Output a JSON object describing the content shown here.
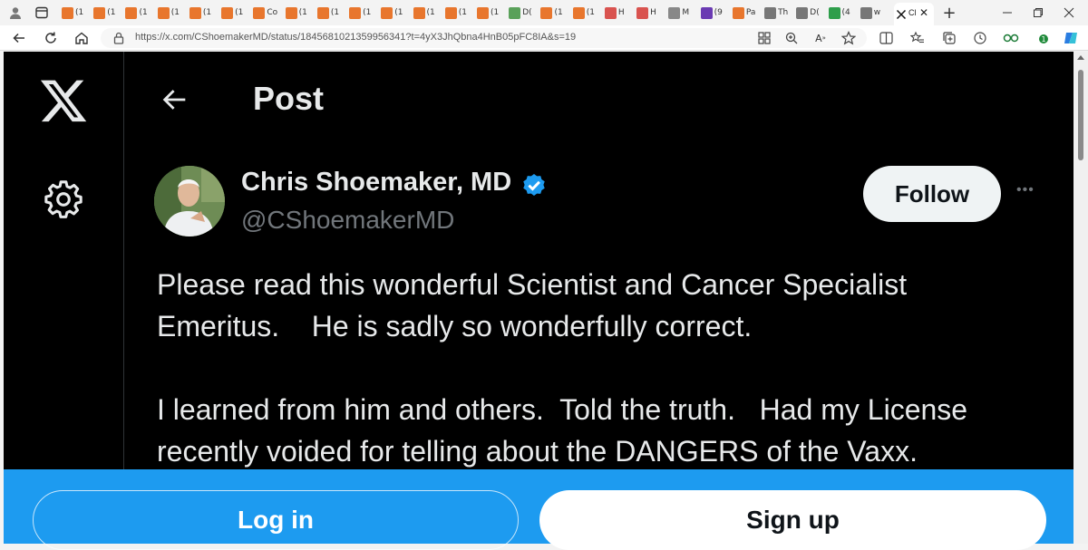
{
  "browser": {
    "tabs": [
      {
        "label": "(1",
        "color": "#e8762d"
      },
      {
        "label": "(1",
        "color": "#e8762d"
      },
      {
        "label": "(1",
        "color": "#e8762d"
      },
      {
        "label": "(1",
        "color": "#e8762d"
      },
      {
        "label": "(1",
        "color": "#e8762d"
      },
      {
        "label": "(1",
        "color": "#e8762d"
      },
      {
        "label": "Co",
        "color": "#e8762d"
      },
      {
        "label": "(1",
        "color": "#e8762d"
      },
      {
        "label": "(1",
        "color": "#e8762d"
      },
      {
        "label": "(1",
        "color": "#e8762d"
      },
      {
        "label": "(1",
        "color": "#e8762d"
      },
      {
        "label": "(1",
        "color": "#e8762d"
      },
      {
        "label": "(1",
        "color": "#e8762d"
      },
      {
        "label": "(1",
        "color": "#e8762d"
      },
      {
        "label": "D(",
        "color": "#5aa15a"
      },
      {
        "label": "(1",
        "color": "#e8762d"
      },
      {
        "label": "(1",
        "color": "#e8762d"
      },
      {
        "label": "H",
        "color": "#d9534f"
      },
      {
        "label": "H",
        "color": "#d9534f"
      },
      {
        "label": "M",
        "color": "#888888"
      },
      {
        "label": "(9",
        "color": "#6a3ab2"
      },
      {
        "label": "Pa",
        "color": "#e8762d"
      },
      {
        "label": "Th",
        "color": "#777777"
      },
      {
        "label": "D(",
        "color": "#777777"
      },
      {
        "label": "(4",
        "color": "#2e9e4b"
      },
      {
        "label": "w",
        "color": "#777777"
      }
    ],
    "active_tab_label": "Cl",
    "url": "https://x.com/CShoemakerMD/status/1845681021359956341?t=4yX3JhQbna4HnB05pFC8IA&s=19"
  },
  "page": {
    "header_title": "Post",
    "author_name": "Chris Shoemaker, MD",
    "author_handle": "@CShoemakerMD",
    "follow_label": "Follow",
    "more_label": "•••",
    "paragraphs": [
      "Please read this wonderful Scientist and Cancer Specialist Emeritus.    He is sadly so wonderfully correct.",
      "I learned from him and others.  Told the truth.   Had my License recently voided for telling about the DANGERS of the Vaxx."
    ]
  },
  "signup_bar": {
    "login_label": "Log in",
    "signup_label": "Sign up"
  },
  "colors": {
    "accent": "#1d9bf0",
    "verified": "#1d9bf0",
    "page_bg": "#000000",
    "text": "#e7e9ea",
    "secondary_text": "#71767b"
  }
}
